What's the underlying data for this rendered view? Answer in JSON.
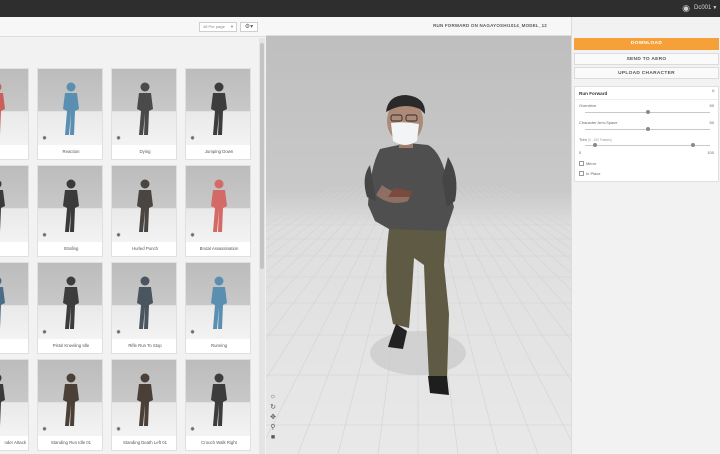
{
  "topbar": {
    "user_label": "Dc001",
    "bell_icon": "bell-icon"
  },
  "toolbar": {
    "per_page": "48 Per page",
    "settings_icon": "gear-icon"
  },
  "grid": {
    "rows": [
      [
        "",
        "Reaction",
        "Dying",
        "Jumping Down"
      ],
      [
        "",
        "Strafing",
        "Hurled Punch",
        "Brutal Assassination"
      ],
      [
        "",
        "Pistol Kneeling Idle",
        "Rifle Run To Stop",
        "Running"
      ],
      [
        "nder Attack",
        "Standing Run Idle 01",
        "Standing Death Left 01",
        "Crouch Walk Right"
      ]
    ]
  },
  "viewer": {
    "title": "RUN FORWARD ON NAGAYOSHI1014_MODEL_12",
    "controls": [
      "sun-icon",
      "rotate-icon",
      "move-icon",
      "zoom-icon",
      "camera-icon"
    ]
  },
  "panel": {
    "download": "DOWNLOAD",
    "send": "SEND TO AERO",
    "upload": "UPLOAD CHARACTER",
    "section_title": "Run Forward",
    "params": [
      {
        "label": "Overdrive",
        "note": "",
        "value": "50",
        "fraction": 0.5
      },
      {
        "label": "Character Arm-Space",
        "note": "",
        "value": "50",
        "fraction": 0.5
      },
      {
        "label": "Trim",
        "note": "(0 - 100 Frames)",
        "value": "",
        "range_low": "0",
        "range_high": "100",
        "fraction_low": 0.08,
        "fraction_high": 0.86
      }
    ],
    "checkboxes": [
      {
        "label": "Mirror",
        "checked": false
      },
      {
        "label": "In Place",
        "checked": false
      }
    ]
  }
}
